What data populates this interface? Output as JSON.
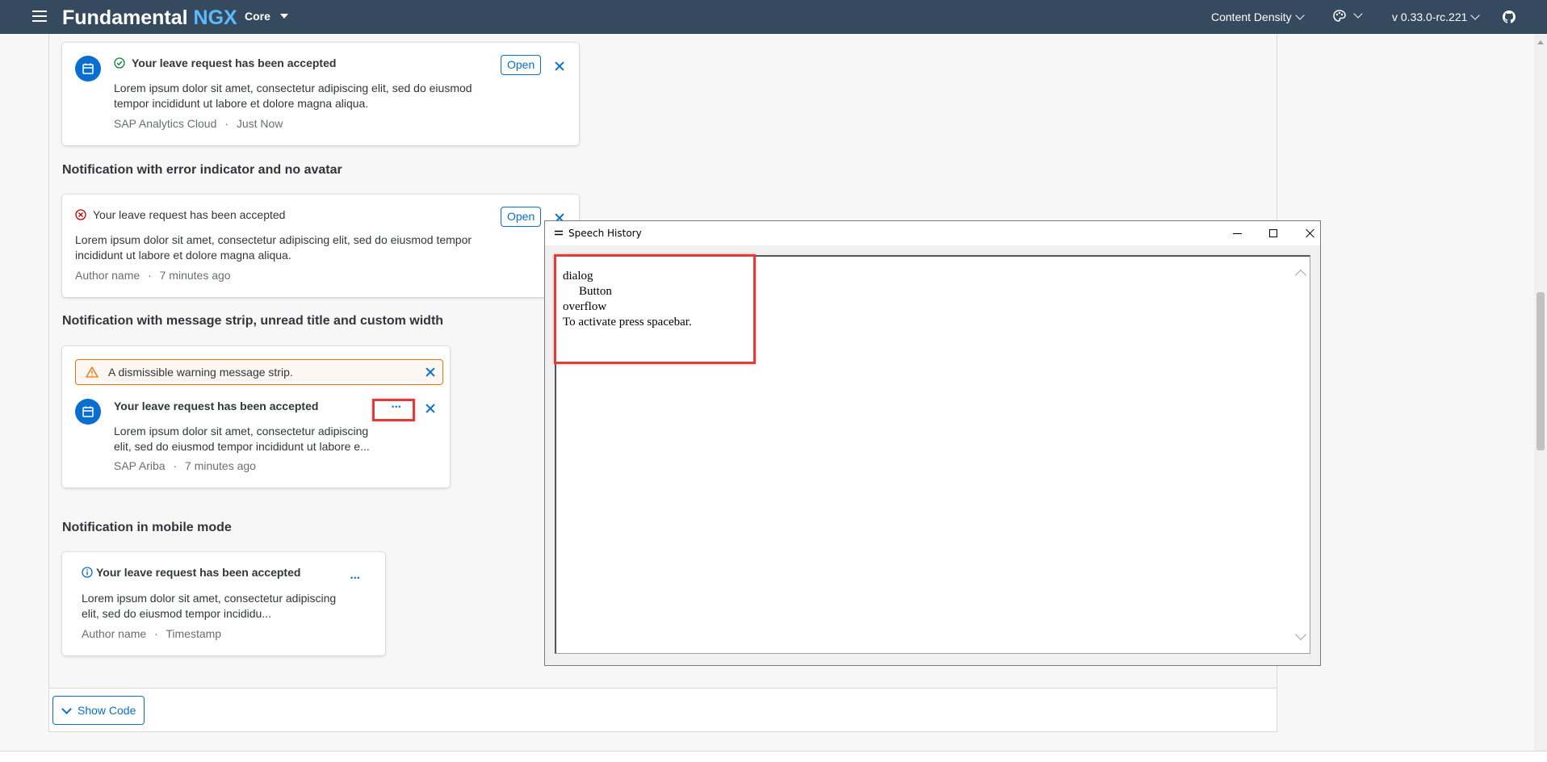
{
  "shellbar": {
    "brand_main": "Fundamental",
    "brand_accent": "NGX",
    "product_menu": "Core",
    "content_density": "Content Density",
    "version": "v 0.33.0-rc.221"
  },
  "cards": {
    "card1": {
      "title": "Your leave request has been accepted",
      "body": "Lorem ipsum dolor sit amet, consectetur adipiscing elit, sed do eiusmod tempor incididunt ut labore et dolore magna aliqua.",
      "author": "SAP Analytics Cloud",
      "separator": "·",
      "time": "Just Now",
      "open_label": "Open"
    },
    "section2_title": "Notification with error indicator and no avatar",
    "card2": {
      "title": "Your leave request has been accepted",
      "body": "Lorem ipsum dolor sit amet, consectetur adipiscing elit, sed do eiusmod tempor incididunt ut labore et dolore magna aliqua.",
      "author": "Author name",
      "separator": "·",
      "time": "7 minutes ago",
      "open_label": "Open"
    },
    "section3_title": "Notification with message strip, unread title and custom width",
    "card3": {
      "strip_text": "A dismissible warning message strip.",
      "title": "Your leave request has been accepted",
      "body": "Lorem ipsum dolor sit amet, consectetur adipiscing elit, sed do eiusmod tempor incididunt ut labore e...",
      "author": "SAP Ariba",
      "separator": "·",
      "time": "7 minutes ago",
      "overflow": "•••"
    },
    "section4_title": "Notification in mobile mode",
    "card4": {
      "title": "Your leave request has been accepted",
      "body": "Lorem ipsum dolor sit amet, consectetur adipiscing elit, sed do eiusmod tempor incididu...",
      "author": "Author name",
      "separator": "·",
      "time": "Timestamp",
      "overflow": "•••"
    }
  },
  "show_code_label": "Show Code",
  "speech_window": {
    "title": "Speech History",
    "lines": [
      "dialog",
      "Button",
      "overflow",
      "To activate press spacebar."
    ]
  },
  "colors": {
    "shellbar": "#354a5f",
    "accent": "#5cbaff",
    "brand_blue": "#0a6ed1",
    "success": "#107e3e",
    "error": "#bb0000",
    "warning": "#e9730c",
    "highlight": "#e03c3c"
  },
  "icons": [
    "menu-icon",
    "palette-icon",
    "github-icon",
    "success-icon",
    "error-icon",
    "warning-icon",
    "information-icon",
    "close-icon"
  ]
}
